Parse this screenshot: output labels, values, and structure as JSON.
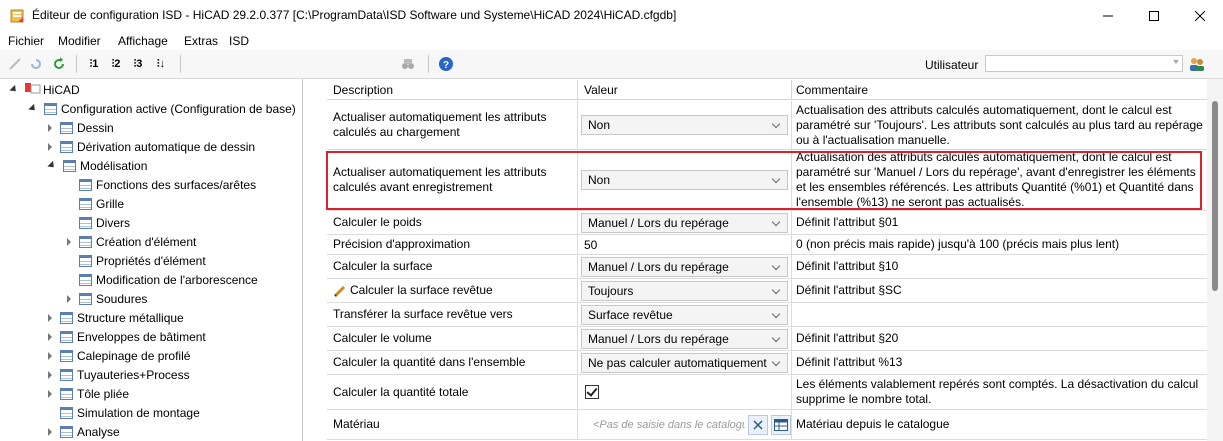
{
  "window": {
    "title": "Éditeur de configuration ISD  -  HiCAD 29.2.0.377 [C:\\ProgramData\\ISD Software und Systeme\\HiCAD 2024\\HiCAD.cfgdb]",
    "minimize_icon": "minimize-icon",
    "maximize_icon": "maximize-icon",
    "close_icon": "close-icon"
  },
  "menu": [
    "Fichier",
    "Modifier",
    "Affichage",
    "Extras",
    "ISD"
  ],
  "toolbar": {
    "user_label": "Utilisateur",
    "user_value": ""
  },
  "tree": [
    {
      "label": "HiCAD",
      "level": 0,
      "state": "expanded",
      "icon": "hicad-icon"
    },
    {
      "label": "Configuration active (Configuration de base)",
      "level": 1,
      "state": "expanded",
      "icon": "config-table-icon"
    },
    {
      "label": "Dessin",
      "level": 2,
      "state": "collapsed",
      "icon": "table-icon"
    },
    {
      "label": "Dérivation automatique de dessin",
      "level": 2,
      "state": "collapsed",
      "icon": "table-icon"
    },
    {
      "label": "Modélisation",
      "level": 2,
      "state": "expanded",
      "icon": "table-icon"
    },
    {
      "label": "Fonctions des surfaces/arêtes",
      "level": 3,
      "state": "leaf",
      "icon": "table-icon"
    },
    {
      "label": "Grille",
      "level": 3,
      "state": "leaf",
      "icon": "table-icon"
    },
    {
      "label": "Divers",
      "level": 3,
      "state": "leaf",
      "icon": "table-icon"
    },
    {
      "label": "Création d'élément",
      "level": 3,
      "state": "collapsed",
      "icon": "table-icon"
    },
    {
      "label": "Propriétés d'élément",
      "level": 3,
      "state": "selected",
      "icon": "table-icon"
    },
    {
      "label": "Modification de l'arborescence",
      "level": 3,
      "state": "leaf",
      "icon": "table-icon"
    },
    {
      "label": "Soudures",
      "level": 3,
      "state": "collapsed",
      "icon": "table-icon"
    },
    {
      "label": "Structure métallique",
      "level": 2,
      "state": "collapsed",
      "icon": "table-icon"
    },
    {
      "label": "Enveloppes de bâtiment",
      "level": 2,
      "state": "collapsed",
      "icon": "table-icon"
    },
    {
      "label": "Calepinage de profilé",
      "level": 2,
      "state": "collapsed",
      "icon": "table-icon"
    },
    {
      "label": "Tuyauteries+Process",
      "level": 2,
      "state": "collapsed",
      "icon": "table-icon"
    },
    {
      "label": "Tôle pliée",
      "level": 2,
      "state": "collapsed",
      "icon": "table-icon"
    },
    {
      "label": "Simulation de montage",
      "level": 2,
      "state": "leaf",
      "icon": "table-icon"
    },
    {
      "label": "Analyse",
      "level": 2,
      "state": "collapsed",
      "icon": "table-icon"
    }
  ],
  "grid": {
    "columns": [
      "Description",
      "Valeur",
      "Commentaire"
    ],
    "rows": [
      {
        "description": "Actualiser automatiquement les attributs calculés au chargement",
        "value_type": "combo",
        "value": "Non",
        "comment": "Actualisation des attributs calculés automatiquement, dont le calcul est paramétré sur 'Toujours'. Les attributs sont calculés au plus tard au repérage ou à l'actualisation manuelle."
      },
      {
        "description": "Actualiser automatiquement les attributs calculés avant enregistrement",
        "value_type": "combo",
        "value": "Non",
        "comment": "Actualisation des attributs calculés automatiquement, dont le calcul est paramétré sur 'Manuel / Lors du repérage', avant d'enregistrer les éléments et les ensembles référencés. Les attributs Quantité (%01) et Quantité dans l'ensemble (%13) ne seront pas actualisés.",
        "highlighted": true
      },
      {
        "description": "Calculer le poids",
        "value_type": "combo",
        "value": "Manuel / Lors du repérage",
        "comment": "Définit l'attribut §01"
      },
      {
        "description": "Précision d'approximation",
        "value_type": "text",
        "value": "50",
        "comment": "0 (non précis mais rapide) jusqu'à 100 (précis mais plus lent)"
      },
      {
        "description": "Calculer la surface",
        "value_type": "combo",
        "value": "Manuel / Lors du repérage",
        "comment": "Définit l'attribut §10"
      },
      {
        "description": "Calculer la surface revêtue",
        "value_type": "combo",
        "value": "Toujours",
        "comment": "Définit l'attribut §SC",
        "edited": true
      },
      {
        "description": "Transférer la surface revêtue vers",
        "value_type": "combo",
        "value": "Surface revêtue",
        "comment": ""
      },
      {
        "description": "Calculer le volume",
        "value_type": "combo",
        "value": "Manuel / Lors du repérage",
        "comment": "Définit l'attribut §20"
      },
      {
        "description": "Calculer la quantité dans l'ensemble",
        "value_type": "combo",
        "value": "Ne pas calculer automatiquement",
        "comment": "Définit l'attribut %13"
      },
      {
        "description": "Calculer la quantité totale",
        "value_type": "checkbox",
        "value": "checked",
        "comment": "Les éléments valablement repérés sont comptés. La désactivation du calcul supprime le nombre total."
      },
      {
        "description": "Matériau",
        "value_type": "catalog",
        "value": "",
        "placeholder": "<Pas de saisie dans le catalogue>",
        "comment": "Matériau depuis le catalogue"
      }
    ]
  },
  "colors": {
    "highlight_border": "#d9232a",
    "selected_tree_bg": "#ffffff",
    "combo_bg": "#f4f4f4"
  }
}
